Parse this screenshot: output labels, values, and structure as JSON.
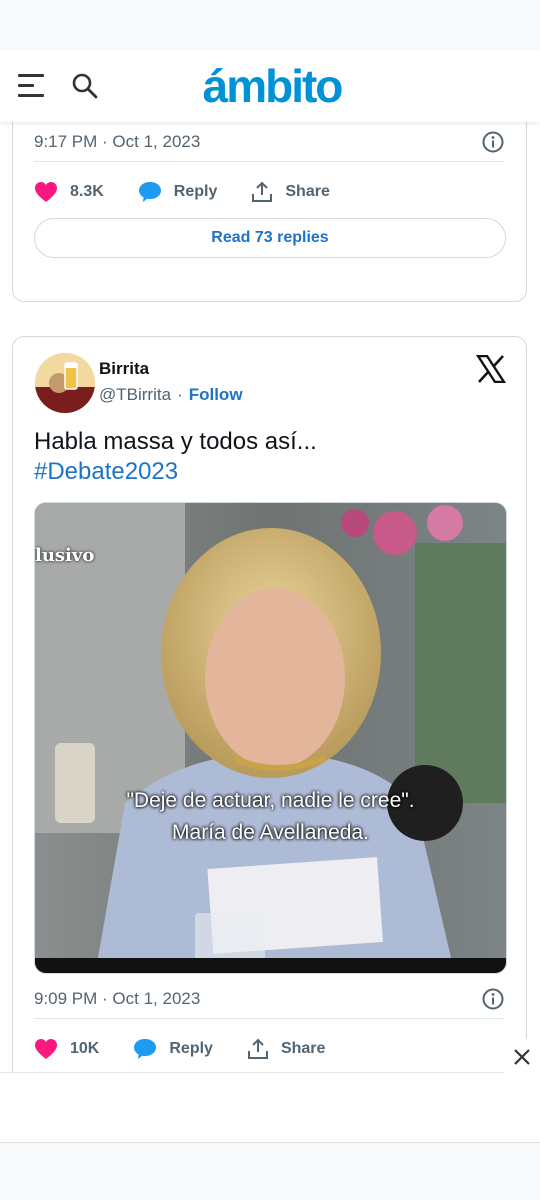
{
  "header": {
    "logo_text": "ámbito",
    "brand_color": "#0092d6",
    "menu_icon": "hamburger-menu-icon",
    "search_icon": "search-icon"
  },
  "tweet1": {
    "timestamp": "9:17 PM · Oct 1, 2023",
    "likes": "8.3K",
    "reply_label": "Reply",
    "share_label": "Share",
    "read_replies": "Read 73 replies"
  },
  "tweet2": {
    "author_name": "Birrita",
    "handle": "@TBirrita",
    "separator": "·",
    "follow_label": "Follow",
    "text": "Habla massa y todos así...",
    "hashtag": "#Debate2023",
    "media": {
      "corner_text": "lusivo",
      "caption_line1": "\"Deje de actuar, nadie le cree\".",
      "caption_line2": "María de Avellaneda."
    },
    "timestamp": "9:09 PM · Oct 1, 2023",
    "likes": "10K",
    "reply_label": "Reply",
    "share_label": "Share"
  },
  "colors": {
    "like": "#f91880",
    "reply": "#1d9bf0",
    "link": "#1d73c9"
  }
}
